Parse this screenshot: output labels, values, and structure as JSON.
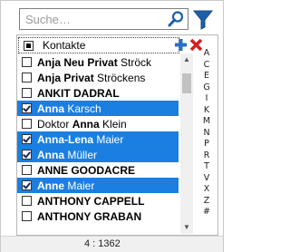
{
  "search": {
    "placeholder": "Suche…",
    "value": ""
  },
  "list_header": {
    "label": "Kontakte"
  },
  "rows": [
    {
      "parts": [
        {
          "t": "Anja Neu Privat",
          "b": true
        },
        {
          "t": " Ströck",
          "b": false
        }
      ],
      "checked": false,
      "selected": false
    },
    {
      "parts": [
        {
          "t": "Anja Privat",
          "b": true
        },
        {
          "t": " Ströckens",
          "b": false
        }
      ],
      "checked": false,
      "selected": false
    },
    {
      "parts": [
        {
          "t": "ANKIT DADRAL",
          "b": true
        }
      ],
      "checked": false,
      "selected": false
    },
    {
      "parts": [
        {
          "t": "Anna",
          "b": true
        },
        {
          "t": " Karsch",
          "b": false
        }
      ],
      "checked": true,
      "selected": true
    },
    {
      "parts": [
        {
          "t": "Doktor ",
          "b": false
        },
        {
          "t": "Anna",
          "b": true
        },
        {
          "t": " Klein",
          "b": false
        }
      ],
      "checked": false,
      "selected": false
    },
    {
      "parts": [
        {
          "t": "Anna-Lena",
          "b": true
        },
        {
          "t": " Maier",
          "b": false
        }
      ],
      "checked": true,
      "selected": true
    },
    {
      "parts": [
        {
          "t": "Anna",
          "b": true
        },
        {
          "t": " Müller",
          "b": false
        }
      ],
      "checked": true,
      "selected": true
    },
    {
      "parts": [
        {
          "t": "ANNE GOODACRE",
          "b": true
        }
      ],
      "checked": false,
      "selected": false
    },
    {
      "parts": [
        {
          "t": "Anne",
          "b": true
        },
        {
          "t": " Maier",
          "b": false
        }
      ],
      "checked": true,
      "selected": true
    },
    {
      "parts": [
        {
          "t": "ANTHONY CAPPELL",
          "b": true
        }
      ],
      "checked": false,
      "selected": false
    },
    {
      "parts": [
        {
          "t": "ANTHONY GRABAN",
          "b": true
        }
      ],
      "checked": false,
      "selected": false
    }
  ],
  "alphabet": [
    "A",
    "C",
    "E",
    "G",
    "I",
    "K",
    "M",
    "N",
    "P",
    "R",
    "T",
    "V",
    "X",
    "Z",
    "#"
  ],
  "status": {
    "text": "4 : 1362"
  },
  "colors": {
    "selection": "#1a7fe0",
    "add_icon": "#2b6cc4",
    "remove_icon": "#d42020",
    "filter_icon": "#1f5fa8"
  }
}
